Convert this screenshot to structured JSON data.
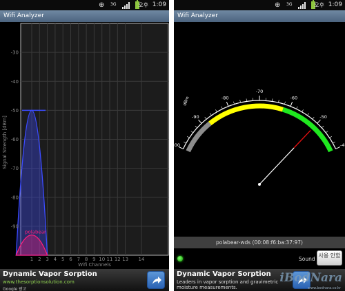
{
  "left_screen": {
    "status": {
      "ampm": "오후",
      "time": "1:09",
      "network": "3G"
    },
    "title": "Wifi Analyzer",
    "chart_data": {
      "type": "area",
      "ylabel": "Signal Strength [dBm]",
      "xlabel": "Wifi Channels",
      "ylim": [
        -100,
        -20
      ],
      "yticks": [
        -30,
        -40,
        -50,
        -60,
        -70,
        -80,
        -90
      ],
      "xticks": [
        "1",
        "2",
        "3",
        "4",
        "5",
        "6",
        "7",
        "8",
        "9",
        "10",
        "11",
        "12",
        "13",
        "14"
      ],
      "series": [
        {
          "name": "",
          "channel": 1,
          "peak_dbm": -50,
          "color": "#3b4bff"
        },
        {
          "name": "polabear",
          "channel": 1,
          "peak_dbm": -93,
          "color": "#ff1e7a"
        }
      ],
      "grid": true
    },
    "ad": {
      "title": "Dynamic Vapor Sorption",
      "url": "www.thesorptionsolution.com",
      "google": "Google 광고"
    }
  },
  "right_screen": {
    "status": {
      "ampm": "오후",
      "time": "1:09",
      "network": "3G"
    },
    "title": "Wifi Analyzer",
    "meter": {
      "unit": "dBm",
      "scale_labels": [
        "-100",
        "-90",
        "-80",
        "-70",
        "-60",
        "-50",
        "-40"
      ],
      "needle_dbm": -50,
      "colors": {
        "gray": "#8c8c8c",
        "yellow": "#ffff00",
        "green": "#1fe81f",
        "needle_tip": "#e01010"
      }
    },
    "network_label": "polabear-wds (00:08:f6:ba:37:97)",
    "sound_label": "Sound",
    "sound_button": "사용 안함",
    "ad": {
      "title": "Dynamic Vapor Sorption",
      "description": "Leaders in vapor sorption and gravimetric moisture measurements."
    },
    "watermark": {
      "text": "iBodNara",
      "sub": "www.bodnara.co.kr"
    }
  }
}
